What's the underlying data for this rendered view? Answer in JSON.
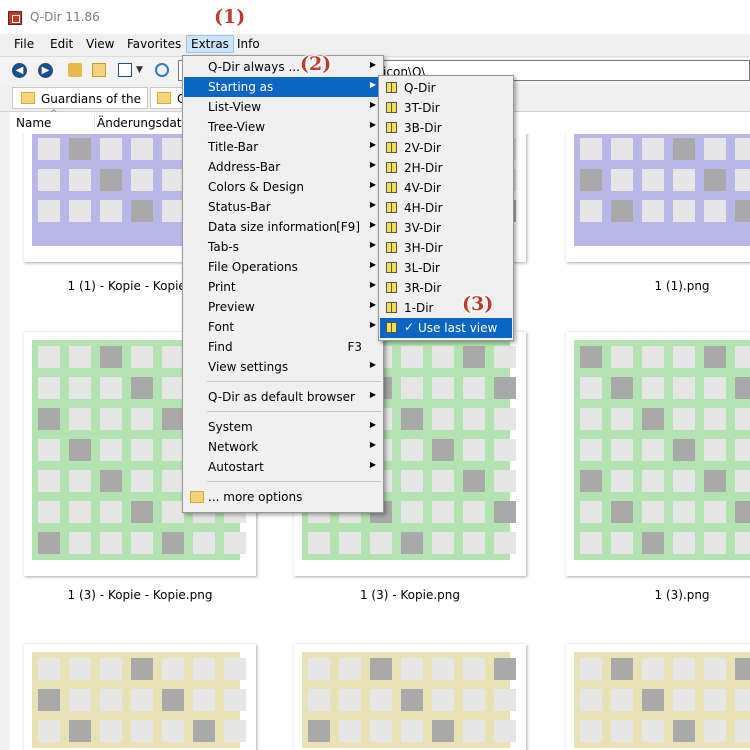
{
  "app": {
    "title": "Q-Dir 11.86"
  },
  "menubar": {
    "items": [
      "File",
      "Edit",
      "View",
      "Favorites",
      "Extras",
      "Info"
    ]
  },
  "address": {
    "value": "\\icon\\Q\\"
  },
  "tabs": [
    {
      "label": "Guardians of the ..."
    },
    {
      "label": "C"
    }
  ],
  "columns": {
    "name": "Name",
    "date": "Änderungsdatum"
  },
  "callouts": [
    "(1)",
    "(2)",
    "(3)"
  ],
  "thumbnails": [
    {
      "label": "1 (1) - Kopie - Kopie.png",
      "palette": "blue"
    },
    {
      "label": "",
      "palette": "blue"
    },
    {
      "label": "1 (1).png",
      "palette": "blue"
    },
    {
      "label": "1 (3) - Kopie - Kopie.png",
      "palette": "green"
    },
    {
      "label": "1 (3) - Kopie.png",
      "palette": "green"
    },
    {
      "label": "1 (3).png",
      "palette": "green"
    },
    {
      "label": "",
      "palette": "yellow"
    },
    {
      "label": "",
      "palette": "yellow"
    },
    {
      "label": "",
      "palette": "yellow"
    }
  ],
  "colors": {
    "blue": "#b9b6e8",
    "green": "#b3e3b0",
    "yellow": "#e8e2b4",
    "highlight": "#0a66c2",
    "callout": "#c0392b"
  },
  "extras_menu": {
    "items": [
      {
        "label": "Q-Dir always ...",
        "arrow": true
      },
      {
        "label": "Starting as",
        "arrow": true,
        "highlighted": true
      },
      {
        "label": "List-View",
        "arrow": true
      },
      {
        "label": "Tree-View",
        "arrow": true
      },
      {
        "label": "Title-Bar",
        "arrow": true
      },
      {
        "label": "Address-Bar",
        "arrow": true
      },
      {
        "label": "Colors & Design",
        "arrow": true
      },
      {
        "label": "Status-Bar",
        "arrow": true
      },
      {
        "label": "Data size information",
        "shortcut": "[F9]",
        "arrow": true
      },
      {
        "label": "Tab-s",
        "arrow": true
      },
      {
        "label": "File Operations",
        "arrow": true
      },
      {
        "label": "Print",
        "arrow": true
      },
      {
        "label": "Preview",
        "arrow": true
      },
      {
        "label": "Font",
        "arrow": true
      },
      {
        "label": "Find",
        "shortcut": "F3"
      },
      {
        "label": "View settings",
        "arrow": true
      },
      {
        "separator": true
      },
      {
        "label": "Q-Dir as default browser",
        "arrow": true
      },
      {
        "separator": true
      },
      {
        "label": "System",
        "arrow": true
      },
      {
        "label": "Network",
        "arrow": true
      },
      {
        "label": "Autostart",
        "arrow": true
      },
      {
        "separator": true
      },
      {
        "label": "... more options",
        "folder": true
      }
    ]
  },
  "starting_as_menu": {
    "items": [
      {
        "label": "Q-Dir"
      },
      {
        "label": "3T-Dir"
      },
      {
        "label": "3B-Dir"
      },
      {
        "label": "2V-Dir"
      },
      {
        "label": "2H-Dir"
      },
      {
        "label": "4V-Dir"
      },
      {
        "label": "4H-Dir"
      },
      {
        "label": "3V-Dir"
      },
      {
        "label": "3H-Dir"
      },
      {
        "label": "3L-Dir"
      },
      {
        "label": "3R-Dir"
      },
      {
        "label": "1-Dir"
      },
      {
        "label": "Use last view",
        "checked": true,
        "highlighted": true
      }
    ]
  }
}
